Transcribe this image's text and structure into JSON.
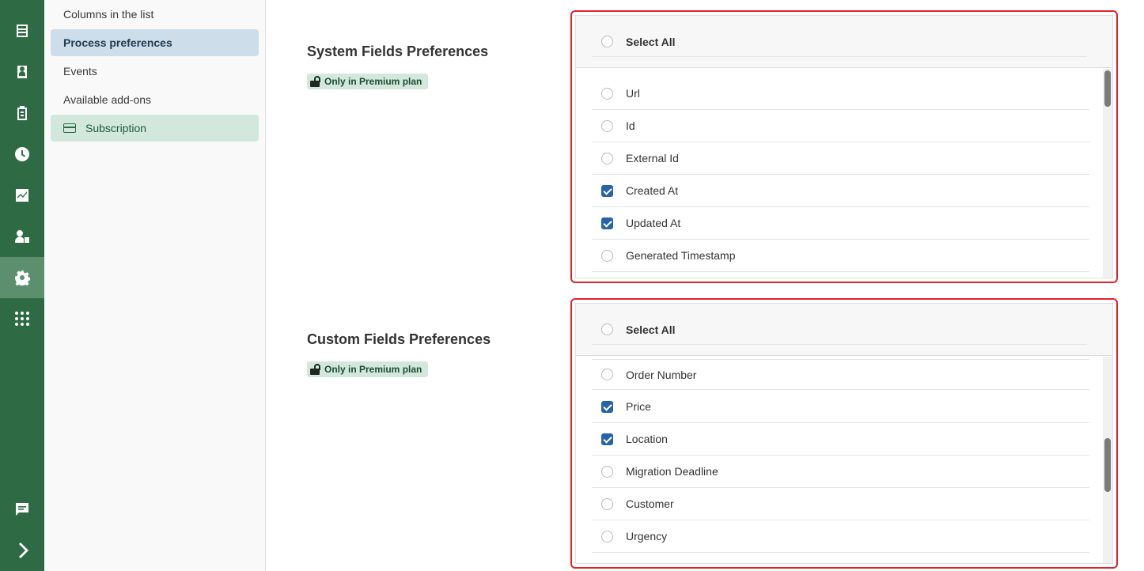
{
  "rail": {
    "items": [
      {
        "icon": "inbox-icon"
      },
      {
        "icon": "contacts-icon"
      },
      {
        "icon": "clipboard-icon"
      },
      {
        "icon": "clock-icon"
      },
      {
        "icon": "chart-icon"
      },
      {
        "icon": "user-lock-icon"
      },
      {
        "icon": "gear-icon",
        "active": true
      },
      {
        "icon": "apps-grid-icon"
      }
    ],
    "bottom": [
      {
        "icon": "chat-icon"
      },
      {
        "icon": "chevron-right-icon"
      }
    ]
  },
  "sidebar": {
    "items": [
      {
        "label": "Columns in the list"
      },
      {
        "label": "Process preferences",
        "active": true
      },
      {
        "label": "Events"
      },
      {
        "label": "Available add-ons"
      },
      {
        "label": "Subscription",
        "icon": "credit-card-icon"
      }
    ]
  },
  "system_fields": {
    "title": "System Fields Preferences",
    "badge": "Only in Premium plan",
    "select_all": "Select All",
    "items": [
      {
        "label": "Url",
        "checked": false
      },
      {
        "label": "Id",
        "checked": false
      },
      {
        "label": "External Id",
        "checked": false
      },
      {
        "label": "Created At",
        "checked": true
      },
      {
        "label": "Updated At",
        "checked": true
      },
      {
        "label": "Generated Timestamp",
        "checked": false
      }
    ]
  },
  "custom_fields": {
    "title": "Custom Fields Preferences",
    "badge": "Only in Premium plan",
    "select_all": "Select All",
    "items": [
      {
        "label": "Order Number",
        "checked": false
      },
      {
        "label": "Price",
        "checked": true
      },
      {
        "label": "Location",
        "checked": true
      },
      {
        "label": "Migration Deadline",
        "checked": false
      },
      {
        "label": "Customer",
        "checked": false
      },
      {
        "label": "Urgency",
        "checked": false
      }
    ]
  },
  "colors": {
    "rail": "#2e6b45",
    "accent_blue": "#2763a8",
    "highlight_red": "#e0232b",
    "badge_green": "#d3e8dc"
  }
}
